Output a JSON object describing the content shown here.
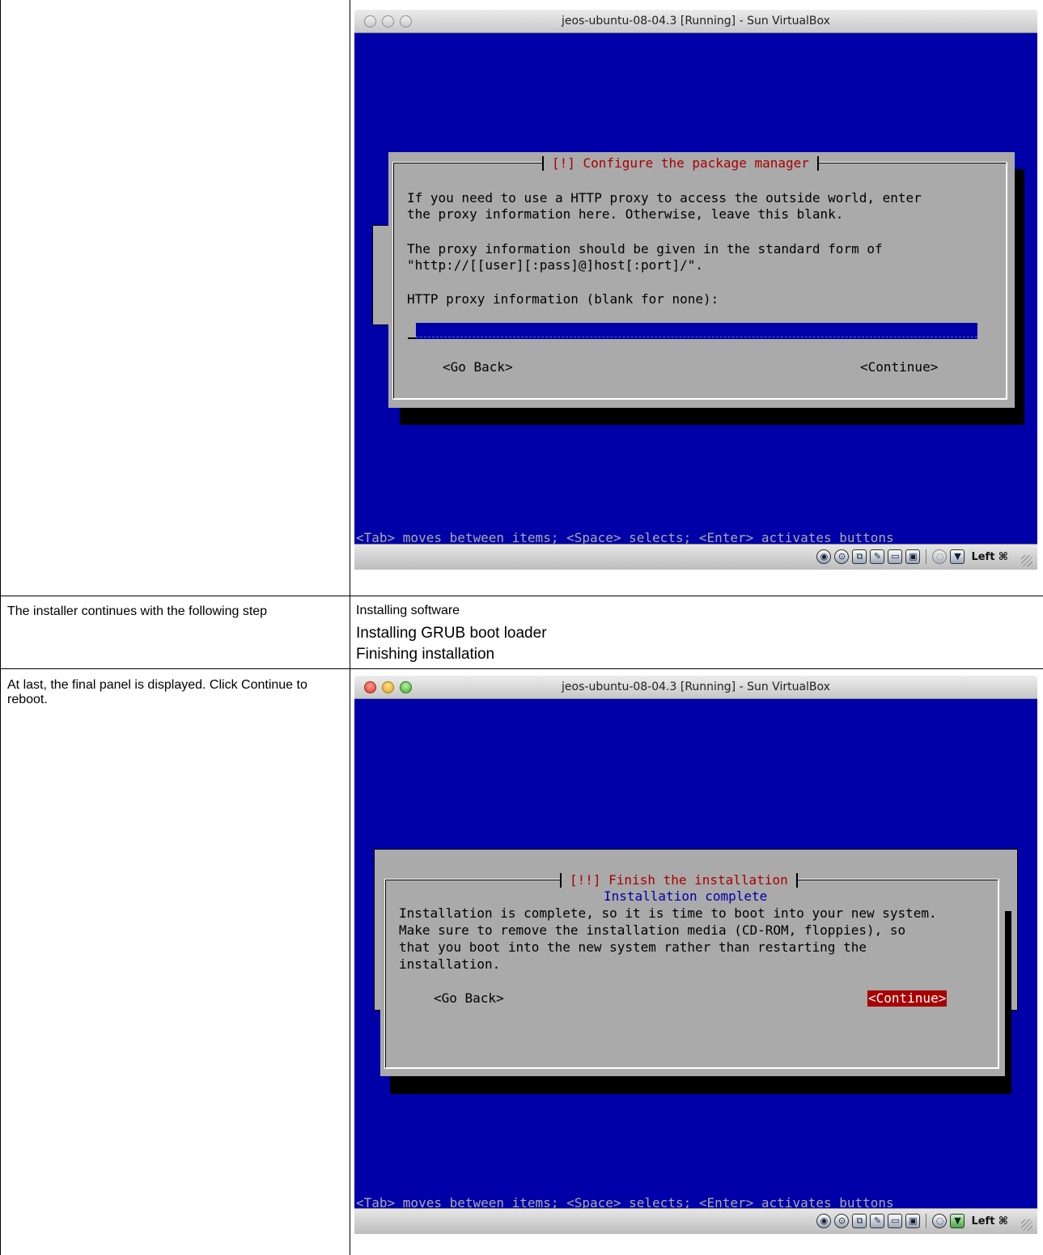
{
  "rows": [
    {
      "left": "",
      "right_items": []
    },
    {
      "left": "The installer continues with the following step",
      "right_items": [
        "Installing software",
        "Installing GRUB boot loader",
        "Finishing installation"
      ]
    },
    {
      "left": "At last, the final panel is displayed. Click Continue to reboot.",
      "right_items": []
    }
  ],
  "window1": {
    "title": "jeos-ubuntu-08-04.3 [Running] - Sun VirtualBox",
    "dialog_title": "[!] Configure the package manager",
    "lines": [
      "If you need to use a HTTP proxy to access the outside world, enter",
      "the proxy information here. Otherwise, leave this blank.",
      "The proxy information should be given in the standard form of",
      "\"http://[[user][:pass]@]host[:port]/\".",
      "HTTP proxy information (blank for none):"
    ],
    "input_value": "",
    "go_back": "<Go Back>",
    "continue": "<Continue>",
    "help": "<Tab> moves between items; <Space> selects; <Enter> activates buttons",
    "status_label": "Left ⌘"
  },
  "window2": {
    "title": "jeos-ubuntu-08-04.3 [Running] - Sun VirtualBox",
    "dialog_title": "[!!] Finish the installation",
    "subtitle": "Installation complete",
    "lines": [
      "Installation is complete, so it is time to boot into your new system.",
      "Make sure to remove the installation media (CD-ROM, floppies), so",
      "that you boot into the new system rather than restarting the",
      "installation."
    ],
    "go_back": "<Go Back>",
    "continue": "<Continue>",
    "help": "<Tab> moves between items; <Space> selects; <Enter> activates buttons",
    "status_label": "Left ⌘"
  },
  "status_icons": [
    "hard-disk-icon",
    "cd-icon",
    "network-icon",
    "usb-icon",
    "shared-folder-icon",
    "display-icon",
    "mouse-integration-icon",
    "host-key-icon"
  ],
  "colors": {
    "screen_blue": "#0000a8",
    "dialog_gray": "#aaaaaa",
    "title_red": "#a80000"
  }
}
